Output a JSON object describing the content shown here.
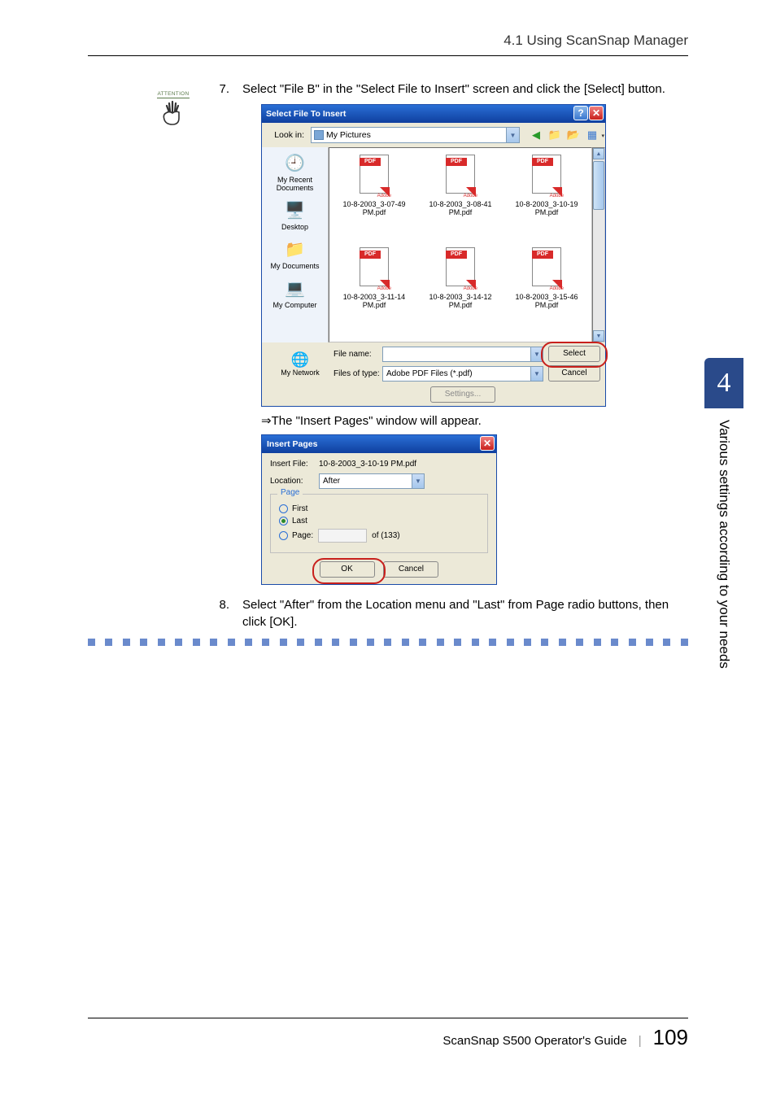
{
  "header": {
    "section": "4.1 Using ScanSnap Manager"
  },
  "attention_label": "ATTENTION",
  "step7": {
    "num": "7.",
    "text": "Select \"File B\" in the \"Select File to Insert\" screen and click the [Select] button."
  },
  "file_dialog": {
    "title": "Select File To Insert",
    "lookin_label": "Look in:",
    "lookin_value": "My Pictures",
    "places": {
      "recent": "My Recent Documents",
      "desktop": "Desktop",
      "mydocs": "My Documents",
      "mycomp": "My Computer",
      "mynet": "My Network"
    },
    "files": [
      "10-8-2003_3-07-49 PM.pdf",
      "10-8-2003_3-08-41 PM.pdf",
      "10-8-2003_3-10-19 PM.pdf",
      "10-8-2003_3-11-14 PM.pdf",
      "10-8-2003_3-14-12 PM.pdf",
      "10-8-2003_3-15-46 PM.pdf"
    ],
    "filename_label": "File name:",
    "filetype_label": "Files of type:",
    "filetype_value": "Adobe PDF Files (*.pdf)",
    "select_btn": "Select",
    "cancel_btn": "Cancel",
    "settings_btn": "Settings..."
  },
  "result_text": "⇒The \"Insert Pages\" window will appear.",
  "insert_dialog": {
    "title": "Insert Pages",
    "file_label": "Insert File:",
    "file_value": "10-8-2003_3-10-19 PM.pdf",
    "location_label": "Location:",
    "location_value": "After",
    "page_legend": "Page",
    "first": "First",
    "last": "Last",
    "page": "Page:",
    "page_of": "of  (133)",
    "ok": "OK",
    "cancel": "Cancel"
  },
  "step8": {
    "num": "8.",
    "text": "Select \"After\" from the Location menu and \"Last\" from Page radio buttons, then click [OK]."
  },
  "sidetab": {
    "chapter": "4",
    "text": "Various settings according to your needs"
  },
  "footer": {
    "guide": "ScanSnap S500 Operator's Guide",
    "page": "109"
  }
}
